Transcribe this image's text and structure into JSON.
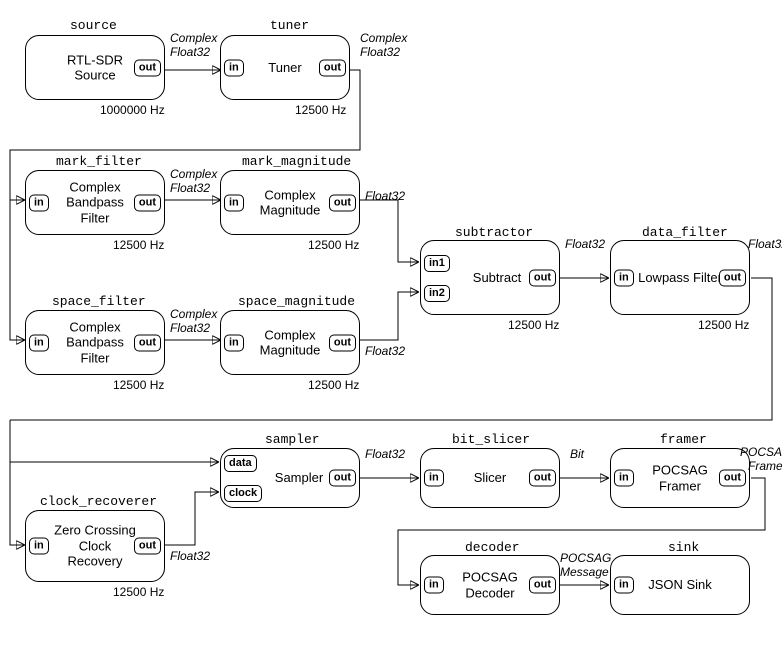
{
  "ports": {
    "in": "in",
    "out": "out",
    "in1": "in1",
    "in2": "in2",
    "data": "data",
    "clock": "clock"
  },
  "edge_types": {
    "complex_float32_a": "Complex",
    "complex_float32_b": "Float32",
    "float32": "Float32",
    "bit": "Bit",
    "pocsag_frame_a": "POCSAG",
    "pocsag_frame_b": "Frame",
    "pocsag_msg_a": "POCSAG",
    "pocsag_msg_b": "Message"
  },
  "blocks": {
    "source": {
      "name": "source",
      "title": "RTL-SDR Source",
      "rate": "1000000 Hz"
    },
    "tuner": {
      "name": "tuner",
      "title": "Tuner",
      "rate": "12500 Hz"
    },
    "mark_filter": {
      "name": "mark_filter",
      "title": "Complex Bandpass Filter",
      "rate": "12500 Hz"
    },
    "mark_magnitude": {
      "name": "mark_magnitude",
      "title": "Complex Magnitude",
      "rate": "12500 Hz"
    },
    "space_filter": {
      "name": "space_filter",
      "title": "Complex Bandpass Filter",
      "rate": "12500 Hz"
    },
    "space_magnitude": {
      "name": "space_magnitude",
      "title": "Complex Magnitude",
      "rate": "12500 Hz"
    },
    "subtractor": {
      "name": "subtractor",
      "title": "Subtract",
      "rate": "12500 Hz"
    },
    "data_filter": {
      "name": "data_filter",
      "title": "Lowpass Filter",
      "rate": "12500 Hz"
    },
    "sampler": {
      "name": "sampler",
      "title": "Sampler",
      "rate": ""
    },
    "bit_slicer": {
      "name": "bit_slicer",
      "title": "Slicer",
      "rate": ""
    },
    "framer": {
      "name": "framer",
      "title": "POCSAG Framer",
      "rate": ""
    },
    "clock_recoverer": {
      "name": "clock_recoverer",
      "title": "Zero Crossing Clock Recovery",
      "rate": "12500 Hz"
    },
    "decoder": {
      "name": "decoder",
      "title": "POCSAG Decoder",
      "rate": ""
    },
    "sink": {
      "name": "sink",
      "title": "JSON Sink",
      "rate": ""
    }
  }
}
